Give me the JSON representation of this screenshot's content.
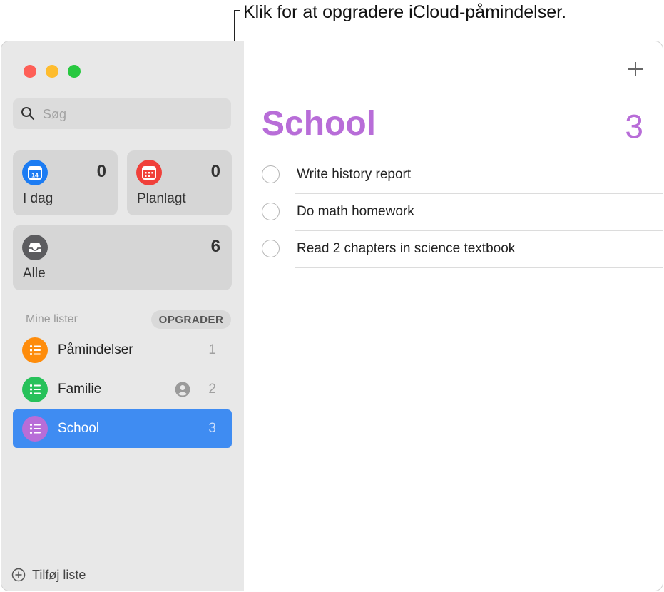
{
  "callout": {
    "text": "Klik for at opgradere iCloud-påmindelser."
  },
  "sidebar": {
    "search_placeholder": "Søg",
    "smart_lists": [
      {
        "label": "I dag",
        "count": "0",
        "icon": "calendar-today-icon",
        "color": "#1c7cf3",
        "day": "14"
      },
      {
        "label": "Planlagt",
        "count": "0",
        "icon": "calendar-scheduled-icon",
        "color": "#f0403a"
      },
      {
        "label": "Alle",
        "count": "6",
        "icon": "tray-icon",
        "color": "#5c5c5f"
      }
    ],
    "section_label": "Mine lister",
    "upgrade_label": "OPGRADER",
    "lists": [
      {
        "label": "Påmindelser",
        "count": "1",
        "color": "#fe8c0b",
        "shared": false,
        "selected": false
      },
      {
        "label": "Familie",
        "count": "2",
        "color": "#27c15a",
        "shared": true,
        "selected": false
      },
      {
        "label": "School",
        "count": "3",
        "color": "#b86dd8",
        "shared": false,
        "selected": true
      }
    ],
    "add_list_label": "Tilføj liste"
  },
  "main": {
    "title": "School",
    "count": "3",
    "title_color": "#b86dd8",
    "reminders": [
      {
        "text": "Write history report"
      },
      {
        "text": "Do math homework"
      },
      {
        "text": "Read 2 chapters in science textbook"
      }
    ]
  }
}
